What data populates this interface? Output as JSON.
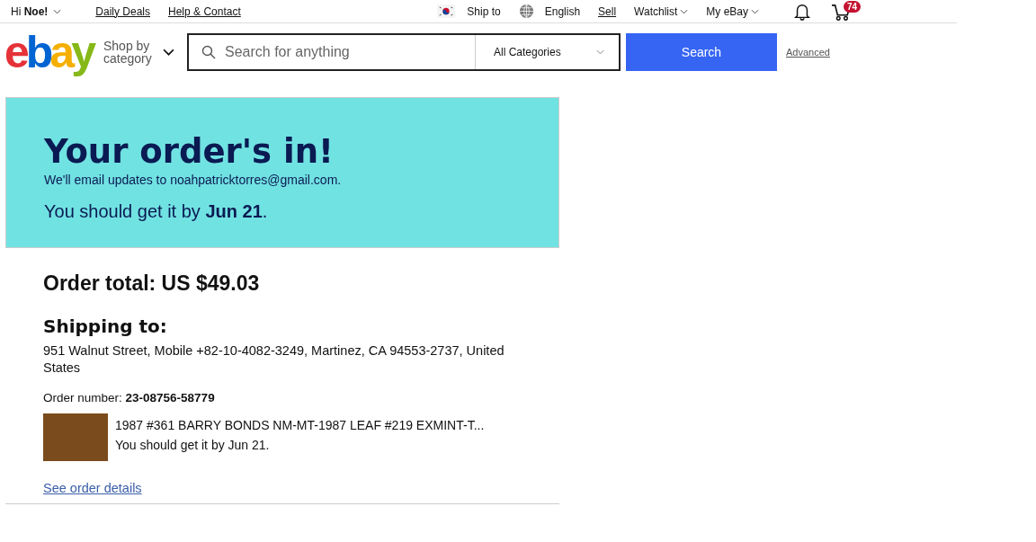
{
  "topbar": {
    "greeting": "Hi **Noe!**",
    "left_links": [
      "Daily Deals",
      "Help & Contact"
    ],
    "ship_to": "Ship to",
    "language": "English",
    "sell": "Sell",
    "watchlist": "Watchlist",
    "my_ebay": "My eBay",
    "cart_count": "74"
  },
  "header": {
    "logo": "ebay",
    "shop_by": "Shop by category",
    "search": {
      "placeholder": "Search for anything"
    },
    "category": "All Categories",
    "search_button": "Search",
    "advanced": "Advanced"
  },
  "banner": {
    "title": "Your order's in!",
    "email_note": "We'll email updates to noahpatricktorres@gmail.com.",
    "delivery": "You should get it by **Jun 21**."
  },
  "order": {
    "total": "Order total: US $49.03",
    "shipping_heading": "Shipping to:",
    "address": "951 Walnut Street, Mobile +82-10-4082-3249, Martinez, CA 94553-2737, United States",
    "order_number": "Order number: **23-08756-58779**",
    "item": {
      "title": "1987 #361 BARRY BONDS NM-MT-1987 LEAF #219 EXMINT-T...",
      "delivery": "You should get it by Jun 21."
    },
    "details_link": "See order details"
  }
}
